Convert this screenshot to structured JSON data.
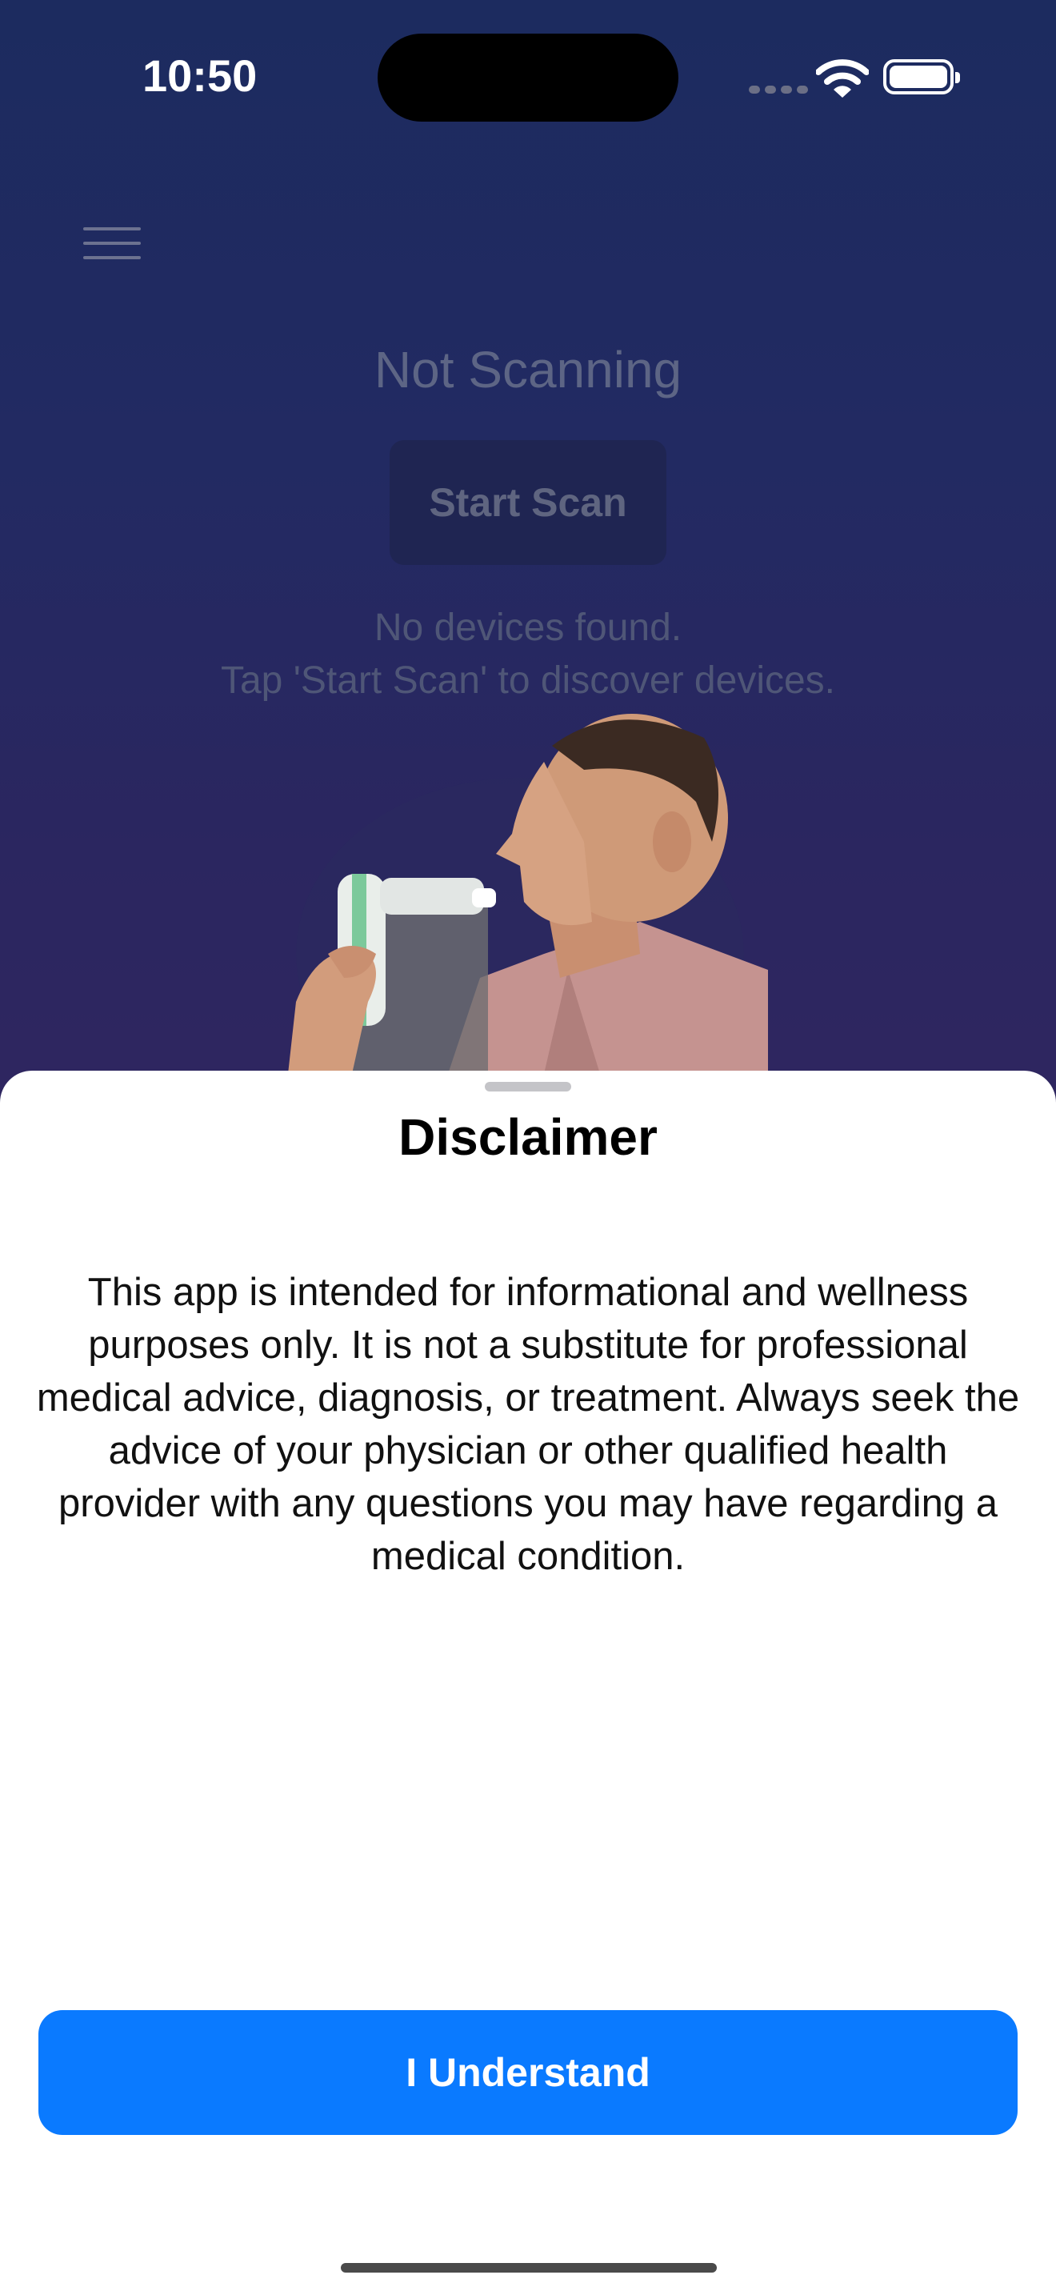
{
  "status_bar": {
    "time": "10:50"
  },
  "main": {
    "scan_status": "Not Scanning",
    "start_scan_label": "Start Scan",
    "no_devices_line1": "No devices found.",
    "no_devices_line2": "Tap 'Start Scan' to discover devices."
  },
  "sheet": {
    "title": "Disclaimer",
    "body": "This app is intended for informational and wellness purposes only. It is not a substitute for professional medical advice, diagnosis, or treatment. Always seek the advice of your physician or other qualified health provider with any questions you may have regarding a medical condition.",
    "button_label": "I Understand"
  },
  "icons": {
    "menu": "hamburger-menu-icon",
    "wifi": "wifi-icon",
    "battery": "battery-icon",
    "signal": "cellular-signal-icon"
  },
  "colors": {
    "accent": "#0A7AFF",
    "background_top": "#1C2B5F",
    "background_bottom": "#2F2660"
  }
}
